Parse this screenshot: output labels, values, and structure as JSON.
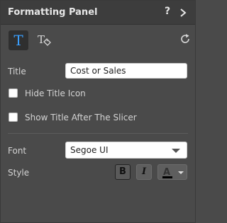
{
  "header": {
    "title": "Formatting Panel",
    "help": "?"
  },
  "toolbar": {
    "text_tool": "T",
    "text_tag_tool": "T"
  },
  "title_field": {
    "label": "Title",
    "value": "Cost or Sales"
  },
  "options": {
    "hide_title_icon": {
      "label": "Hide Title Icon",
      "checked": false
    },
    "show_title_after": {
      "label": "Show Title After The Slicer",
      "checked": false
    }
  },
  "font": {
    "label": "Font",
    "value": "Segoe UI"
  },
  "style": {
    "label": "Style",
    "bold": "B",
    "italic": "I",
    "color_letter": "A",
    "color": "#000000"
  },
  "icons": [
    "help-icon",
    "chevron-right-icon",
    "text-icon",
    "text-tag-icon",
    "reset-icon",
    "caret-down-icon"
  ]
}
